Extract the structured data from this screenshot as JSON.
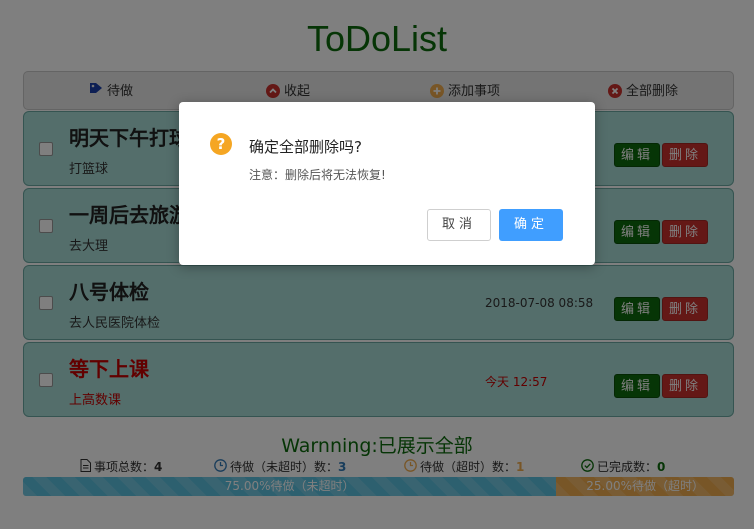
{
  "app": {
    "title": "ToDoList"
  },
  "toolbar": {
    "pending_label": "待做",
    "collapse_label": "收起",
    "add_label": "添加事项",
    "delete_all_label": "全部删除"
  },
  "todos": [
    {
      "title": "明天下午打球",
      "desc": "打篮球",
      "time": "",
      "overdue": false
    },
    {
      "title": "一周后去旅游",
      "desc": "去大理",
      "time": "",
      "overdue": false
    },
    {
      "title": "八号体检",
      "desc": "去人民医院体检",
      "time": "2018-07-08 08:58",
      "overdue": false
    },
    {
      "title": "等下上课",
      "desc": "上高数课",
      "time": "今天 12:57",
      "overdue": true
    }
  ],
  "actions": {
    "edit_label": "编辑",
    "delete_label": "删除"
  },
  "warning": "Warnning:已展示全部",
  "stats": {
    "total_label": "事项总数：",
    "total_value": "4",
    "pending_label": "待做（未超时）数：",
    "pending_value": "3",
    "overdue_label": "待做（超时）数：",
    "overdue_value": "1",
    "done_label": "已完成数：",
    "done_value": "0"
  },
  "progress": {
    "pending_fraction": 0.75,
    "pending_label": "75.00%待做（未超时）",
    "overdue_fraction": 0.25,
    "overdue_label": "25.00%待做（超时）"
  },
  "dialog": {
    "title": "确定全部删除吗?",
    "note": "注意：删除后将无法恢复!",
    "cancel_label": "取消",
    "confirm_label": "确定"
  },
  "colors": {
    "brand_green": "#0d6b0d",
    "danger_red": "#c9302c",
    "info_blue": "#5bc0de",
    "warning_orange": "#f0ad4e",
    "confirm_blue": "#409eff"
  }
}
